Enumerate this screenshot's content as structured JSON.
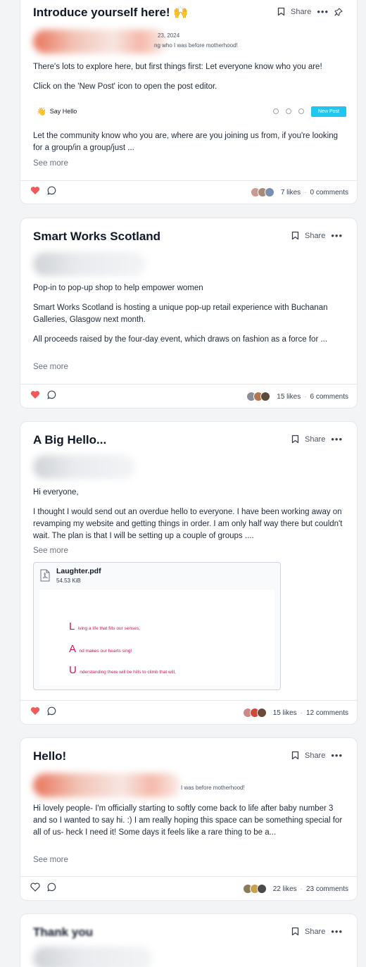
{
  "colors": {
    "accent": "#22c4f0",
    "heart": "#f05a5a",
    "poem": "#d4145a"
  },
  "posts": [
    {
      "title": "Introduce yourself here! 🙌",
      "share_label": "Share",
      "author_date": "23, 2024",
      "author_bio": "ng who I was before motherhood!",
      "paragraphs": [
        "There's lots to explore here, but first things first: Let everyone know who you are!",
        "Click on the 'New Post' icon to open the post editor."
      ],
      "embed": {
        "label": "Say Hello",
        "button": "New Post"
      },
      "paragraph_after": "Let the community know who you are, where are you joining us from, if you're looking for a group/in a group/just ...",
      "see_more": "See more",
      "likes": "7 likes",
      "comments": "0 comments",
      "liked": true,
      "pinned": true
    },
    {
      "title": "Smart Works Scotland",
      "share_label": "Share",
      "paragraphs": [
        "Pop-in to pop-up shop to help empower women",
        "Smart Works Scotland is hosting a unique pop-up retail experience with Buchanan Galleries, Glasgow next month.",
        "All proceeds raised by the four-day event, which draws on fashion as a force for ..."
      ],
      "see_more": "See more",
      "likes": "15 likes",
      "comments": "6 comments",
      "liked": true
    },
    {
      "title": "A Big Hello...",
      "share_label": "Share",
      "paragraphs": [
        "Hi everyone,",
        "I thought I would send out an overdue hello to everyone. I have been working away on revamping my website and getting things in order. I am only half way there but couldn't wait. The plan is that I will be setting up a couple of groups ...."
      ],
      "see_more": "See more",
      "attachment": {
        "name": "Laughter.pdf",
        "size": "54.53 KiB",
        "lines": [
          {
            "cap": "L",
            "rest": "iving a life that fills our senses,"
          },
          {
            "cap": "A",
            "rest": "nd makes our hearts sing!"
          },
          {
            "cap": "U",
            "rest": "nderstanding there will be hills to climb that will,"
          }
        ]
      },
      "likes": "15 likes",
      "comments": "12 comments",
      "liked": true
    },
    {
      "title": "Hello!",
      "share_label": "Share",
      "author_bio": "I was before motherhood!",
      "paragraphs": [
        "Hi lovely people- I'm officially starting to softly come back to life after baby number 3 and so I wanted to say hi. :) I am really hoping this space can be something special for all of us- heck I need it! Some days it feels like a rare thing to be a..."
      ],
      "see_more": "See more",
      "likes": "22 likes",
      "comments": "23 comments",
      "liked": false
    },
    {
      "title": "Thank you",
      "share_label": "Share"
    }
  ]
}
